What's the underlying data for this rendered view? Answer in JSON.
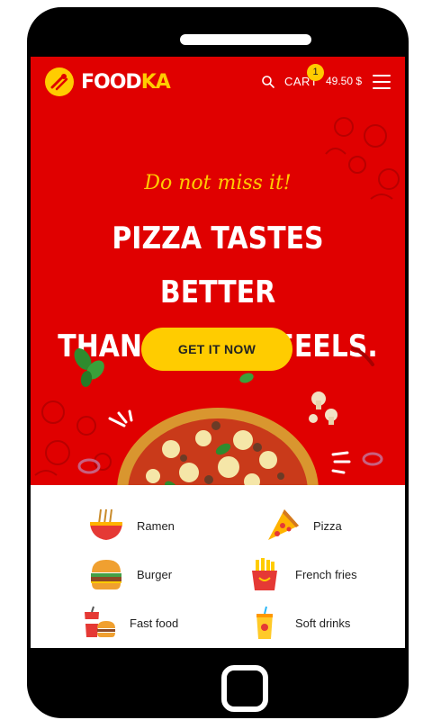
{
  "header": {
    "brand_main": "FOOD",
    "brand_accent": "KA",
    "cart_label": "CART",
    "cart_count": "1",
    "cart_total": "49.50 $",
    "icons": [
      "logo-icon",
      "search-icon",
      "menu-icon"
    ]
  },
  "hero": {
    "tagline": "Do not miss it!",
    "headline_line1": "PIZZA TASTES BETTER",
    "headline_line2": "THAN SKINNY FEELS.",
    "cta_label": "GET IT NOW"
  },
  "categories": [
    {
      "label": "Ramen",
      "icon": "ramen-icon"
    },
    {
      "label": "Pizza",
      "icon": "pizza-slice-icon"
    },
    {
      "label": "Burger",
      "icon": "burger-icon"
    },
    {
      "label": "French fries",
      "icon": "french-fries-icon"
    },
    {
      "label": "Fast food",
      "icon": "fast-food-icon"
    },
    {
      "label": "Soft drinks",
      "icon": "soft-drink-icon"
    }
  ],
  "colors": {
    "hero_red": "#e00000",
    "accent_yellow": "#ffcc00",
    "frame": "#000000"
  }
}
